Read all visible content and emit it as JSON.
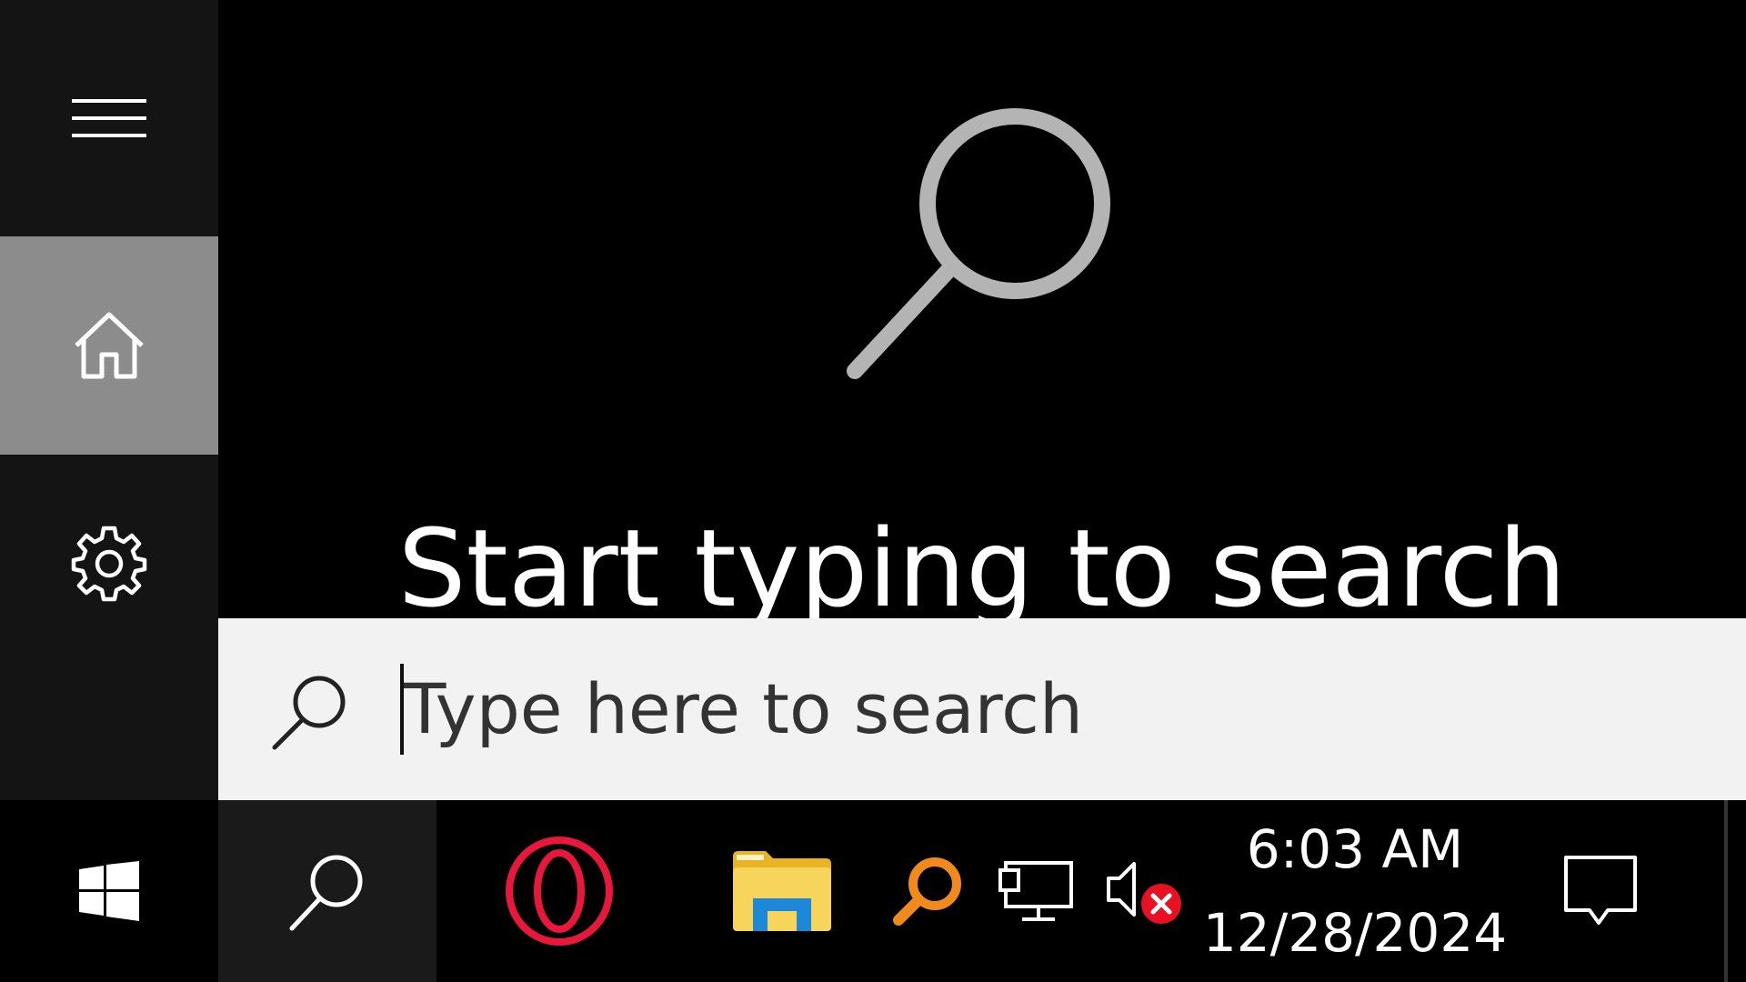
{
  "sidebar": {
    "menu_icon": "hamburger-menu-icon",
    "home_icon": "home-icon",
    "settings_icon": "gear-icon",
    "active_item_color": "#8c8c8c"
  },
  "main": {
    "hero_icon": "search-icon",
    "hint_text": "Start typing to search"
  },
  "searchbar": {
    "icon": "search-icon",
    "placeholder": "Type here to search",
    "value": ""
  },
  "taskbar": {
    "start_icon": "windows-logo-icon",
    "search_icon": "search-icon",
    "apps": [
      {
        "name": "Opera",
        "icon": "opera-icon",
        "color": "#e8173c"
      },
      {
        "name": "File Explorer",
        "icon": "folder-icon",
        "color": "#f5c842"
      },
      {
        "name": "Search tool",
        "icon": "magnifier-orange-icon",
        "color": "#f08a1c"
      }
    ],
    "tray": {
      "network_icon": "network-icon",
      "volume_icon": "volume-muted-icon",
      "volume_error_color": "#e81123"
    },
    "clock": {
      "time": "6:03 AM",
      "date": "12/28/2024"
    },
    "action_center_icon": "action-center-icon"
  }
}
